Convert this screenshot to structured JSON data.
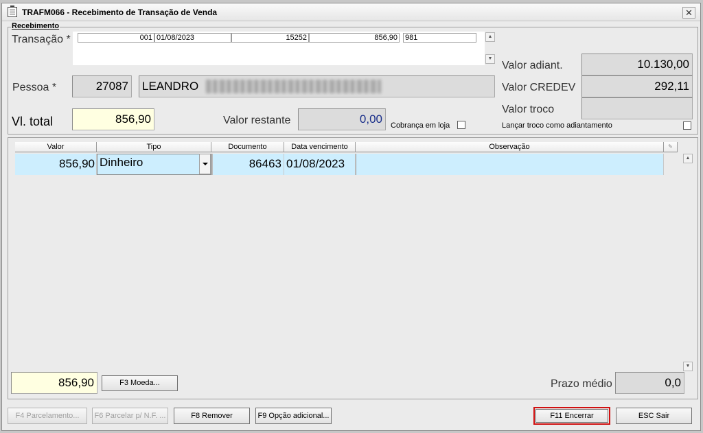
{
  "window": {
    "title": "TRAFM066 - Recebimento de Transação de Venda",
    "close_glyph": "✕"
  },
  "group": {
    "label": "Recebimento"
  },
  "transacao": {
    "label": "Transação *",
    "cells": [
      "001",
      "01/08/2023",
      "15252",
      "856,90",
      "981"
    ]
  },
  "pessoa": {
    "label": "Pessoa *",
    "code": "27087",
    "name": "LEANDRO"
  },
  "totals": {
    "vl_total_label": "Vl. total",
    "vl_total": "856,90",
    "valor_restante_label": "Valor restante",
    "valor_restante": "0,00",
    "cobranca_label": "Cobrança em loja",
    "cobranca_checked": false
  },
  "side": {
    "valor_adiant_label": "Valor adiant.",
    "valor_adiant": "10.130,00",
    "valor_credev_label": "Valor CREDEV",
    "valor_credev": "292,11",
    "valor_troco_label": "Valor troco",
    "valor_troco": "",
    "lancar_troco_label": "Lançar troco como adiantamento",
    "lancar_troco_checked": false
  },
  "grid": {
    "columns": [
      "Valor",
      "Tipo",
      "Documento",
      "Data vencimento",
      "Observação"
    ],
    "rows": [
      {
        "valor": "856,90",
        "tipo": "Dinheiro",
        "documento": "86463",
        "data": "01/08/2023",
        "obs": ""
      }
    ]
  },
  "footer": {
    "total": "856,90",
    "moeda_button": "F3 Moeda...",
    "prazo_label": "Prazo médio",
    "prazo_value": "0,0"
  },
  "actions": {
    "parcelamento": "F4 Parcelamento...",
    "parcelar_nf": "F6 Parcelar p/ N.F. ...",
    "remover": "F8 Remover",
    "opcao_adicional": "F9 Opção adicional...",
    "encerrar": "F11 Encerrar",
    "sair": "ESC Sair"
  },
  "colors": {
    "row_highlight": "#cdeefe",
    "yellow_field": "#ffffe1",
    "focus_ring": "#d01010",
    "valor_restante_text": "#1a2f8a"
  }
}
